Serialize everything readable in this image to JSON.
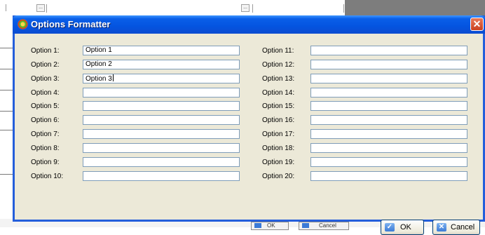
{
  "dialog": {
    "title": "Options Formatter",
    "close_symbol": "✕",
    "ok_label": "OK",
    "cancel_label": "Cancel",
    "ok_icon": "check-icon",
    "cancel_icon": "x-icon"
  },
  "options_left": [
    {
      "label": "Option 1:",
      "value": "Option 1"
    },
    {
      "label": "Option 2:",
      "value": "Option 2"
    },
    {
      "label": "Option 3:",
      "value": "Option 3"
    },
    {
      "label": "Option 4:",
      "value": ""
    },
    {
      "label": "Option 5:",
      "value": ""
    },
    {
      "label": "Option 6:",
      "value": ""
    },
    {
      "label": "Option 7:",
      "value": ""
    },
    {
      "label": "Option 8:",
      "value": ""
    },
    {
      "label": "Option 9:",
      "value": ""
    },
    {
      "label": "Option 10:",
      "value": ""
    }
  ],
  "options_right": [
    {
      "label": "Option 11:",
      "value": ""
    },
    {
      "label": "Option 12:",
      "value": ""
    },
    {
      "label": "Option 13:",
      "value": ""
    },
    {
      "label": "Option 14:",
      "value": ""
    },
    {
      "label": "Option 15:",
      "value": ""
    },
    {
      "label": "Option 16:",
      "value": ""
    },
    {
      "label": "Option 17:",
      "value": ""
    },
    {
      "label": "Option 18:",
      "value": ""
    },
    {
      "label": "Option 19:",
      "value": ""
    },
    {
      "label": "Option 20:",
      "value": ""
    }
  ],
  "background_window": {
    "ellipsis_label": "...",
    "ok_label": "OK",
    "cancel_label": "Cancel"
  },
  "colors": {
    "title_bar": "#0454e0",
    "dialog_face": "#ece9d8",
    "input_border": "#7f9db9",
    "close_button": "#c9401f"
  }
}
